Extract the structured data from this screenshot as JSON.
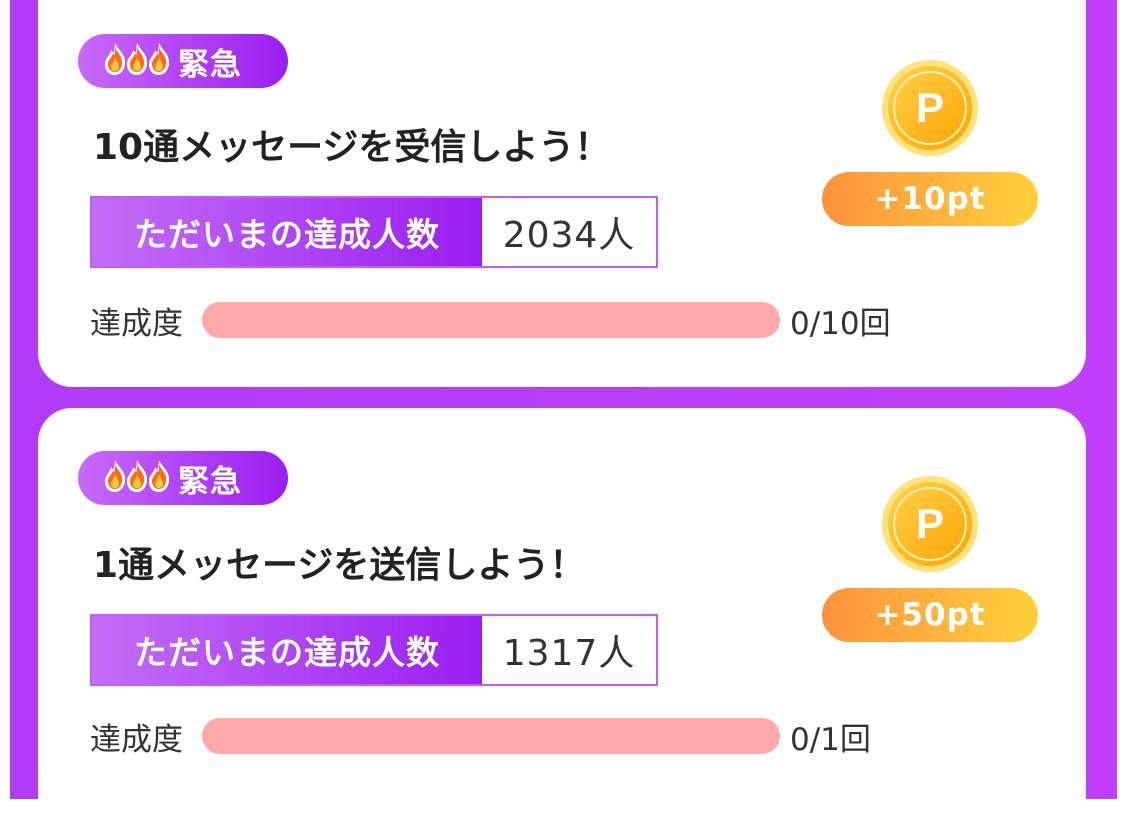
{
  "missions": [
    {
      "badge": "緊急",
      "title": "10通メッセージを受信しよう！",
      "stat_label": "ただいまの達成人数",
      "stat_value": "2034人",
      "progress_label": "達成度",
      "progress_text": "0/10回",
      "progress_fraction": 0,
      "coin_letter": "P",
      "reward": "+10pt"
    },
    {
      "badge": "緊急",
      "title": "1通メッセージを送信しよう！",
      "stat_label": "ただいまの達成人数",
      "stat_value": "1317人",
      "progress_label": "達成度",
      "progress_text": "0/1回",
      "progress_fraction": 0,
      "coin_letter": "P",
      "reward": "+50pt"
    }
  ],
  "icons": {
    "badge_icon": "flame-icon",
    "reward_icon": "point-coin-icon"
  },
  "colors": {
    "background": "#bf3ffb",
    "badge_gradient": [
      "#c86af8",
      "#9b1df0"
    ],
    "progress_track": "#ffa9aa",
    "reward_gradient": [
      "#ff923c",
      "#ffd13a"
    ],
    "coin": "#ffc21a"
  }
}
